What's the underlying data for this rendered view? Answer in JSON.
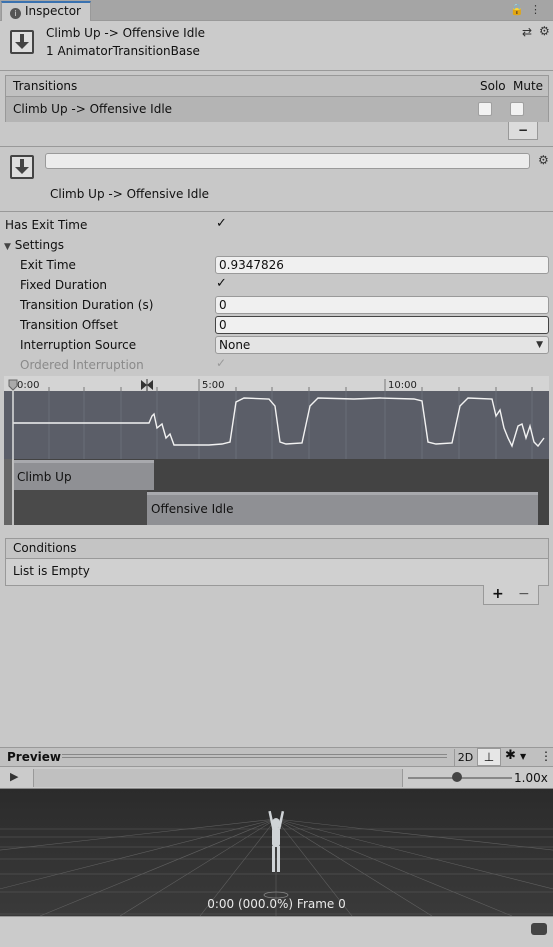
{
  "tab": {
    "title": "Inspector"
  },
  "header": {
    "title": "Climb Up -> Offensive Idle",
    "subtitle": "1 AnimatorTransitionBase"
  },
  "transitions": {
    "header": "Transitions",
    "col_solo": "Solo",
    "col_mute": "Mute",
    "row": "Climb Up -> Offensive Idle",
    "minus": "−"
  },
  "transition": {
    "name_value": "",
    "label": "Climb Up -> Offensive Idle"
  },
  "settings": {
    "has_exit_time_label": "Has Exit Time",
    "settings_label": "Settings",
    "exit_time_label": "Exit Time",
    "exit_time_value": "0.9347826",
    "fixed_duration_label": "Fixed Duration",
    "transition_duration_label": "Transition Duration (s)",
    "transition_duration_value": "0",
    "transition_offset_label": "Transition Offset",
    "transition_offset_value": "0",
    "interruption_source_label": "Interruption Source",
    "interruption_source_value": "None",
    "ordered_interruption_label": "Ordered Interruption",
    "has_exit_time_checked": true,
    "fixed_duration_checked": true,
    "ordered_interruption_checked": true
  },
  "timeline": {
    "ticks": [
      "0:00",
      "5:00",
      "10:00"
    ],
    "track1": "Climb Up",
    "track2": "Offensive Idle"
  },
  "conditions": {
    "header": "Conditions",
    "empty": "List is Empty",
    "plus": "+",
    "minus": "−"
  },
  "preview": {
    "title": "Preview",
    "btn_2d": "2D",
    "speed": "1.00x",
    "status": "0:00 (000.0%) Frame 0"
  },
  "colors": {
    "accent": "#3a72b0",
    "timeline_bg": "#5a5d66",
    "viewport_bg": "#2b2b2b"
  }
}
